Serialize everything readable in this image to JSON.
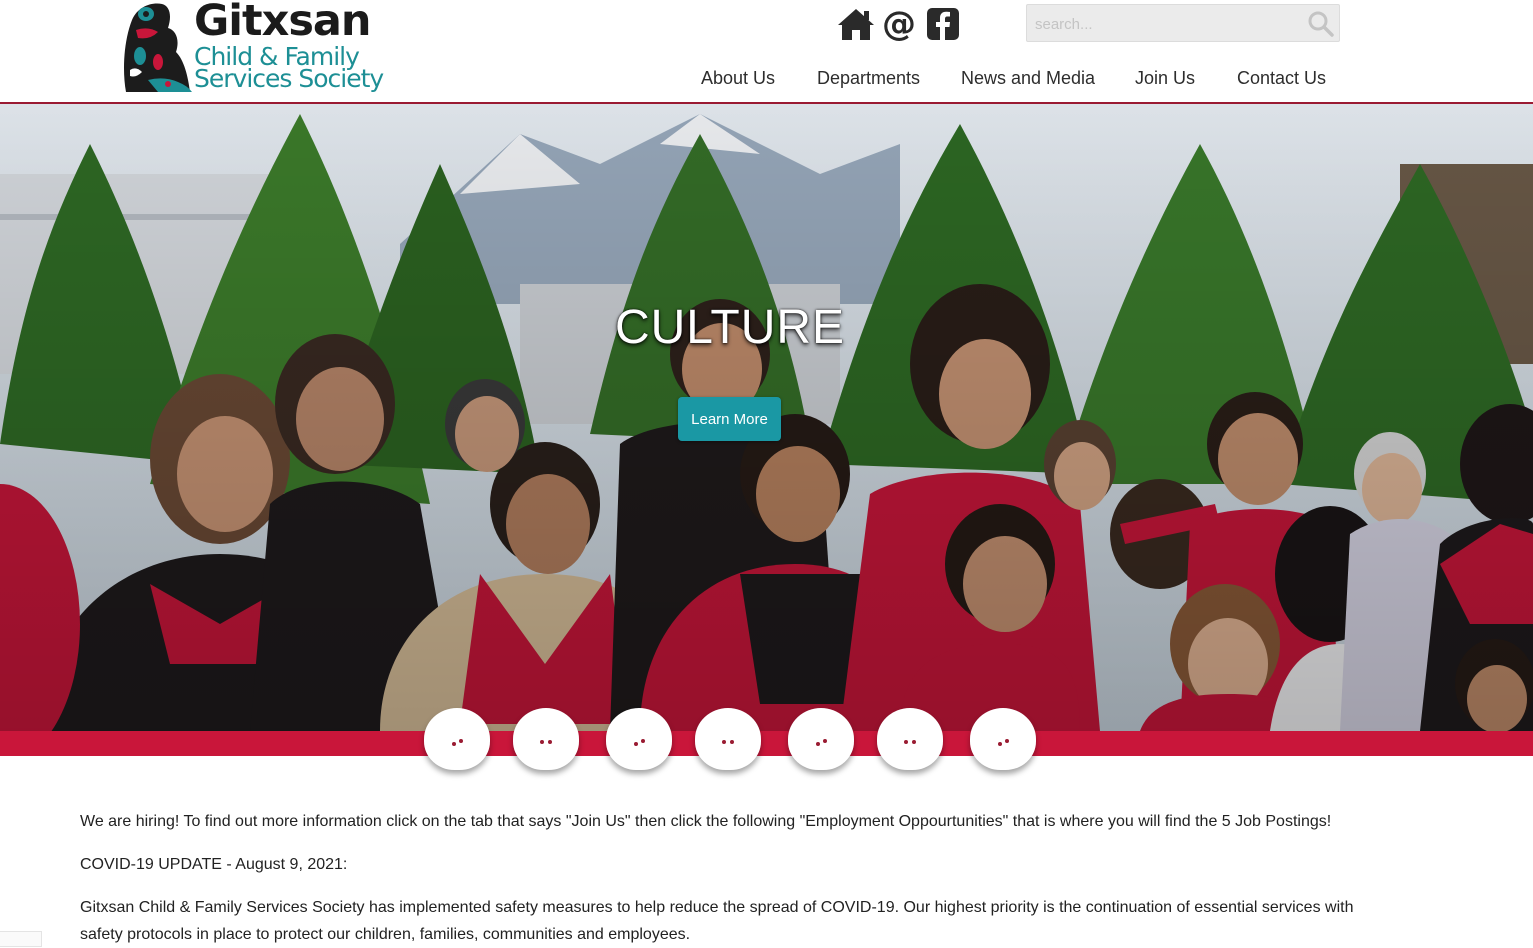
{
  "header": {
    "logo": {
      "line1": "Gitxsan",
      "line2": "Child & Family",
      "line3": "Services Society"
    },
    "icons": {
      "home": "home-icon",
      "email": "email-icon",
      "email_glyph": "@",
      "facebook": "facebook-icon"
    },
    "search": {
      "placeholder": "search...",
      "value": "",
      "button_icon": "search-icon"
    },
    "nav": [
      {
        "label": "About Us"
      },
      {
        "label": "Departments"
      },
      {
        "label": "News and Media"
      },
      {
        "label": "Join Us"
      },
      {
        "label": "Contact Us"
      }
    ]
  },
  "hero": {
    "title": "CULTURE",
    "button_label": "Learn More",
    "slide_count": 7
  },
  "content": {
    "paragraph1": "We are hiring! To find out more information click on the tab that says \"Join Us\" then click the following \"Employment Oppourtunities\" that is where you will find the 5 Job Postings!",
    "paragraph2": "COVID-19 UPDATE - August 9, 2021:",
    "paragraph3": "Gitxsan Child & Family Services Society has implemented safety measures to help reduce the spread of COVID-19.  Our highest priority is the continuation of essential services with safety protocols in place to protect our children, families, communities and employees."
  },
  "colors": {
    "accent_teal": "#1a98a4",
    "band_red": "#c9163a",
    "header_line": "#9a1b32",
    "logo_teal": "#1d8f95"
  }
}
